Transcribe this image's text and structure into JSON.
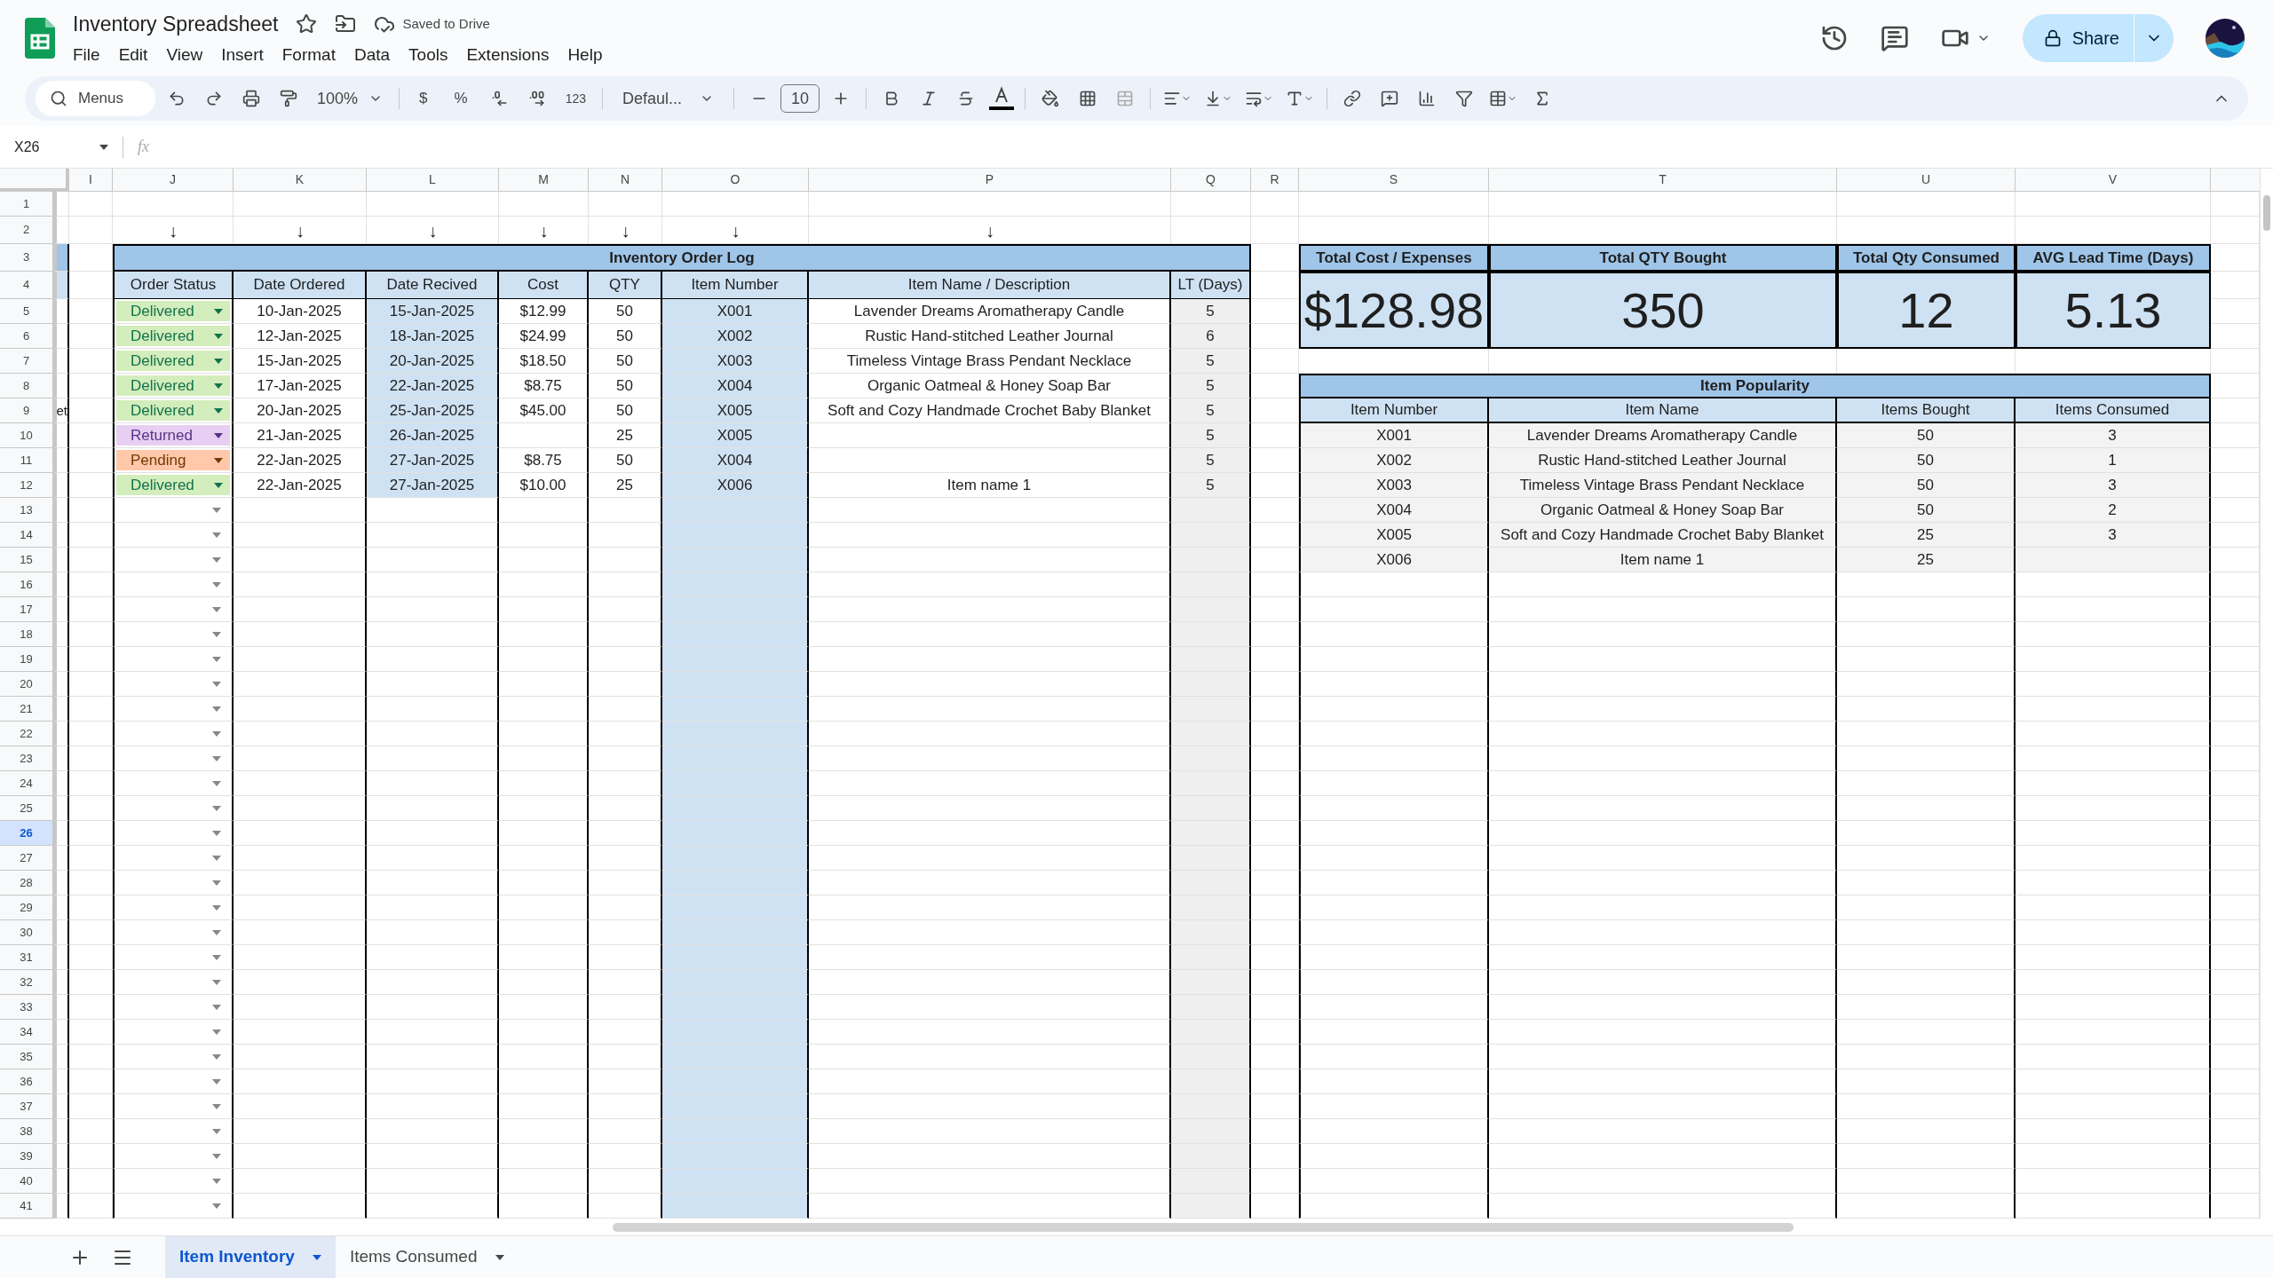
{
  "window": {
    "title": "Inventory Spreadsheet",
    "save_status": "Saved to Drive"
  },
  "menu": [
    "File",
    "Edit",
    "View",
    "Insert",
    "Format",
    "Data",
    "Tools",
    "Extensions",
    "Help"
  ],
  "share_button": {
    "label": "Share"
  },
  "toolbar": {
    "search": {
      "placeholder": "Menus"
    },
    "zoom": "100%",
    "currency": "$",
    "percent": "%",
    "number_format": "123",
    "font": "Defaul...",
    "font_size": "10"
  },
  "formula_bar": {
    "name_box": "X26",
    "label": "fx"
  },
  "grid": {
    "column_letters": [
      "I",
      "J",
      "K",
      "L",
      "M",
      "N",
      "O",
      "P",
      "Q",
      "R",
      "S",
      "T",
      "U",
      "V"
    ],
    "rows": [
      {
        "label": "1",
        "selected": false
      },
      {
        "label": "2",
        "selected": false
      },
      {
        "label": "3",
        "selected": false
      },
      {
        "label": "4",
        "selected": false
      },
      {
        "label": "5",
        "selected": false
      },
      {
        "label": "6",
        "selected": false
      },
      {
        "label": "7",
        "selected": false
      },
      {
        "label": "8",
        "selected": false
      },
      {
        "label": "9",
        "selected": false
      },
      {
        "label": "10",
        "selected": false
      },
      {
        "label": "11",
        "selected": false
      },
      {
        "label": "12",
        "selected": false
      },
      {
        "label": "13",
        "selected": false
      },
      {
        "label": "14",
        "selected": false
      },
      {
        "label": "15",
        "selected": false
      },
      {
        "label": "16",
        "selected": false
      },
      {
        "label": "17",
        "selected": false
      },
      {
        "label": "18",
        "selected": false
      },
      {
        "label": "19",
        "selected": false
      },
      {
        "label": "20",
        "selected": false
      },
      {
        "label": "21",
        "selected": false
      },
      {
        "label": "22",
        "selected": false
      },
      {
        "label": "23",
        "selected": false
      },
      {
        "label": "24",
        "selected": false
      },
      {
        "label": "25",
        "selected": false
      },
      {
        "label": "26",
        "selected": true
      },
      {
        "label": "27",
        "selected": false
      },
      {
        "label": "28",
        "selected": false
      },
      {
        "label": "29",
        "selected": false
      },
      {
        "label": "30",
        "selected": false
      },
      {
        "label": "31",
        "selected": false
      },
      {
        "label": "32",
        "selected": false
      },
      {
        "label": "33",
        "selected": false
      },
      {
        "label": "34",
        "selected": false
      },
      {
        "label": "35",
        "selected": false
      },
      {
        "label": "36",
        "selected": false
      },
      {
        "label": "37",
        "selected": false
      },
      {
        "label": "38",
        "selected": false
      },
      {
        "label": "39",
        "selected": false
      },
      {
        "label": "40",
        "selected": false
      },
      {
        "label": "41",
        "selected": false
      }
    ],
    "column_h_fragment": "et"
  },
  "order_log": {
    "title": "Inventory Order Log",
    "arrows": [
      "↓",
      "↓",
      "↓",
      "↓",
      "↓",
      "↓",
      "↓"
    ],
    "columns": [
      "Order Status",
      "Date Ordered",
      "Date Recived",
      "Cost",
      "QTY",
      "Item Number",
      "Item Name / Description",
      "LT (Days)"
    ],
    "rows": [
      {
        "status": {
          "label": "Delivered",
          "kind": "delivered"
        },
        "date_ordered": "10-Jan-2025",
        "date_received": "15-Jan-2025",
        "cost": "$12.99",
        "qty": "50",
        "item_number": "X001",
        "item_name": "Lavender Dreams Aromatherapy Candle",
        "lt": "5"
      },
      {
        "status": {
          "label": "Delivered",
          "kind": "delivered"
        },
        "date_ordered": "12-Jan-2025",
        "date_received": "18-Jan-2025",
        "cost": "$24.99",
        "qty": "50",
        "item_number": "X002",
        "item_name": "Rustic Hand-stitched Leather Journal",
        "lt": "6"
      },
      {
        "status": {
          "label": "Delivered",
          "kind": "delivered"
        },
        "date_ordered": "15-Jan-2025",
        "date_received": "20-Jan-2025",
        "cost": "$18.50",
        "qty": "50",
        "item_number": "X003",
        "item_name": "Timeless Vintage Brass Pendant Necklace",
        "lt": "5"
      },
      {
        "status": {
          "label": "Delivered",
          "kind": "delivered"
        },
        "date_ordered": "17-Jan-2025",
        "date_received": "22-Jan-2025",
        "cost": "$8.75",
        "qty": "50",
        "item_number": "X004",
        "item_name": "Organic Oatmeal & Honey Soap Bar",
        "lt": "5"
      },
      {
        "status": {
          "label": "Delivered",
          "kind": "delivered"
        },
        "date_ordered": "20-Jan-2025",
        "date_received": "25-Jan-2025",
        "cost": "$45.00",
        "qty": "50",
        "item_number": "X005",
        "item_name": "Soft and Cozy Handmade Crochet Baby Blanket",
        "lt": "5"
      },
      {
        "status": {
          "label": "Returned",
          "kind": "returned"
        },
        "date_ordered": "21-Jan-2025",
        "date_received": "26-Jan-2025",
        "qty": "25",
        "item_number": "X005",
        "lt": "5"
      },
      {
        "status": {
          "label": "Pending",
          "kind": "pending"
        },
        "date_ordered": "22-Jan-2025",
        "date_received": "27-Jan-2025",
        "cost": "$8.75",
        "qty": "50",
        "item_number": "X004",
        "lt": "5"
      },
      {
        "status": {
          "label": "Delivered",
          "kind": "delivered"
        },
        "date_ordered": "22-Jan-2025",
        "date_received": "27-Jan-2025",
        "cost": "$10.00",
        "qty": "25",
        "item_number": "X006",
        "item_name": "Item name 1",
        "lt": "5"
      }
    ]
  },
  "summary": [
    {
      "label": "Total Cost / Expenses",
      "value": "$128.98"
    },
    {
      "label": "Total QTY Bought",
      "value": "350"
    },
    {
      "label": "Total Qty Consumed",
      "value": "12"
    },
    {
      "label": "AVG Lead Time (Days)",
      "value": "5.13"
    }
  ],
  "item_popularity": {
    "title": "Item Popularity",
    "columns": [
      "Item Number",
      "Item Name",
      "Items Bought",
      "Items Consumed"
    ],
    "rows": [
      [
        "X001",
        "Lavender Dreams Aromatherapy Candle",
        "50",
        "3"
      ],
      [
        "X002",
        "Rustic Hand-stitched Leather Journal",
        "50",
        "1"
      ],
      [
        "X003",
        "Timeless Vintage Brass Pendant Necklace",
        "50",
        "3"
      ],
      [
        "X004",
        "Organic Oatmeal & Honey Soap Bar",
        "50",
        "2"
      ],
      [
        "X005",
        "Soft and Cozy Handmade Crochet Baby Blanket",
        "25",
        "3"
      ],
      [
        "X006",
        "Item name 1",
        "25"
      ]
    ]
  },
  "sheet_tabs": [
    {
      "label": "Item Inventory",
      "selected": true
    },
    {
      "label": "Items Consumed",
      "selected": false
    }
  ]
}
